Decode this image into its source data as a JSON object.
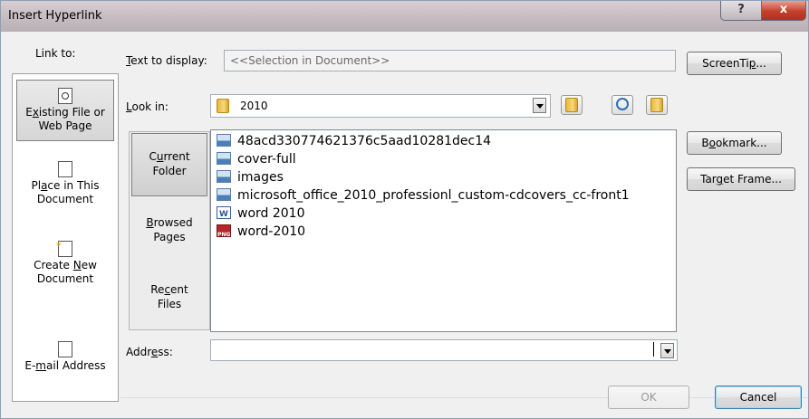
{
  "dialog": {
    "title": "Insert Hyperlink",
    "help_label": "?",
    "close_label": "x"
  },
  "link_to": {
    "heading": "Link to:",
    "items": [
      {
        "prefix": "E",
        "accel": "x",
        "rest": "isting File or",
        "line2": "Web Page",
        "selected": true
      },
      {
        "prefix": "Pl",
        "accel": "a",
        "rest": "ce in This",
        "line2": "Document",
        "selected": false
      },
      {
        "prefix": "Create ",
        "accel": "N",
        "rest": "ew",
        "line2": "Document",
        "selected": false
      },
      {
        "prefix": "E-",
        "accel": "m",
        "rest": "ail Address",
        "line2": "",
        "selected": false
      }
    ]
  },
  "text_to_display": {
    "accel": "T",
    "rest": "ext to display:",
    "value": "<<Selection in Document>>"
  },
  "screentip_button": {
    "prefix": "ScreenTi",
    "accel": "p",
    "rest": "..."
  },
  "look_in": {
    "accel": "L",
    "rest": "ook in:",
    "value": "2010"
  },
  "nav": {
    "items": [
      {
        "prefix": "C",
        "accel": "u",
        "rest": "rrent",
        "line2": "Folder",
        "selected": true
      },
      {
        "prefix": "",
        "accel": "B",
        "rest": "rowsed",
        "line2": "Pages",
        "selected": false
      },
      {
        "prefix": "Re",
        "accel": "c",
        "rest": "ent",
        "line2": "Files",
        "selected": false
      }
    ]
  },
  "files": [
    {
      "name": "48acd330774621376c5aad10281dec14",
      "icon": "image-file-icon"
    },
    {
      "name": "cover-full",
      "icon": "image-file-icon"
    },
    {
      "name": "images",
      "icon": "image-file-icon"
    },
    {
      "name": "microsoft_office_2010_professionl_custom-cdcovers_cc-front1",
      "icon": "image-file-icon"
    },
    {
      "name": "word 2010",
      "icon": "word-document-icon"
    },
    {
      "name": "word-2010",
      "icon": "png-file-icon"
    }
  ],
  "side_buttons": {
    "bookmark": {
      "prefix": "B",
      "accel": "o",
      "rest": "okmark..."
    },
    "target_frame": {
      "prefix": "Tar",
      "accel": "g",
      "rest": "et Frame..."
    }
  },
  "address": {
    "prefix": "Addr",
    "accel": "e",
    "rest": "ss:",
    "value": ""
  },
  "ok_label": "OK",
  "cancel_label": "Cancel"
}
